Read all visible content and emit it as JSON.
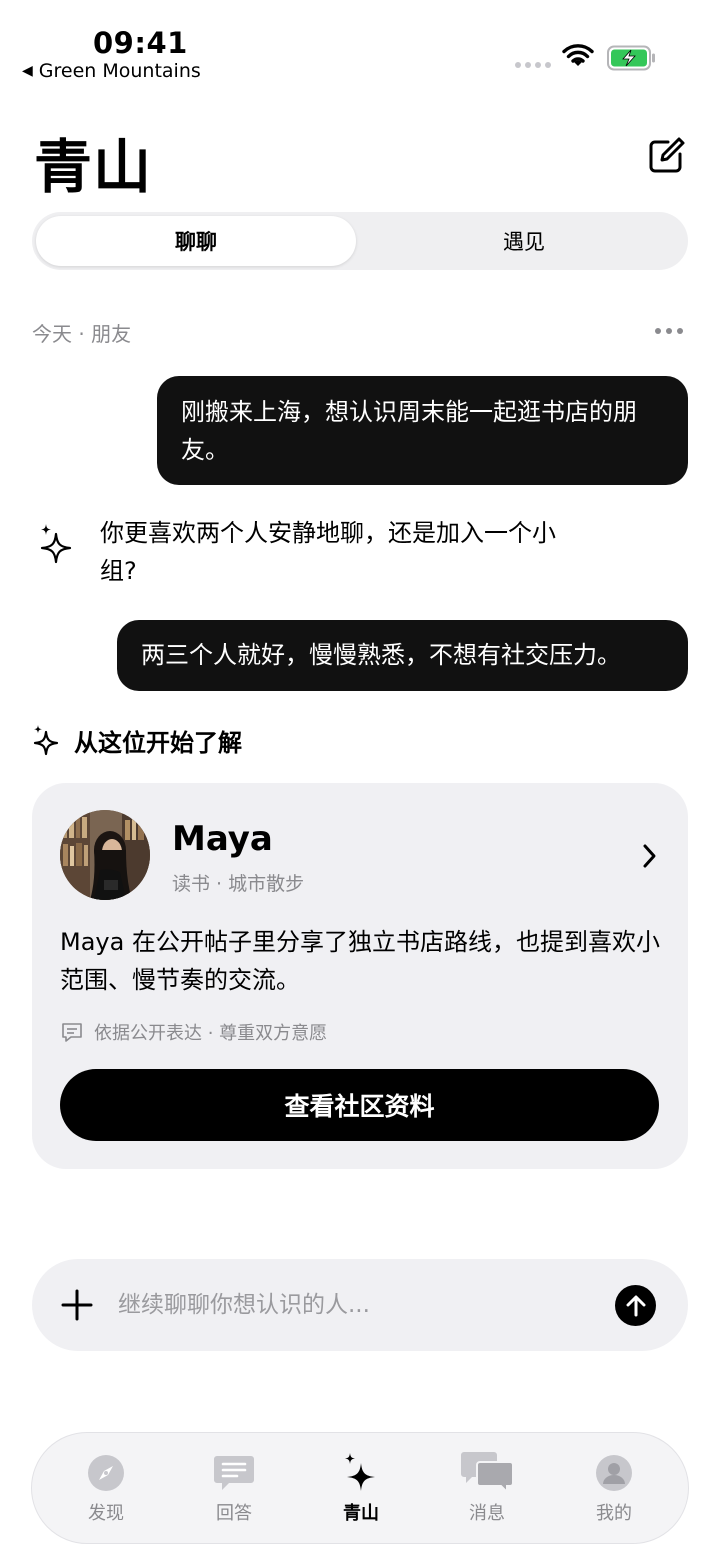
{
  "status_bar": {
    "time": "09:41",
    "back_label": "Green Mountains",
    "battery_color": "#34c759"
  },
  "header": {
    "title": "青山",
    "compose_icon": "compose-icon"
  },
  "segmented": {
    "tabs": [
      {
        "label": "聊聊",
        "selected": true
      },
      {
        "label": "遇见",
        "selected": false
      }
    ]
  },
  "chat": {
    "meta": "今天 · 朋友",
    "messages": [
      {
        "role": "user",
        "text": "刚搬来上海，想认识周末能一起逛书店的朋友。"
      },
      {
        "role": "assistant",
        "text": "你更喜欢两个人安静地聊，还是加入一个小组?"
      },
      {
        "role": "user",
        "text": "两三个人就好，慢慢熟悉，不想有社交压力。"
      }
    ],
    "section_label": "从这位开始了解"
  },
  "profile_card": {
    "name": "Maya",
    "tags": "读书 · 城市散步",
    "description": "Maya 在公开帖子里分享了独立书店路线，也提到喜欢小范围、慢节奏的交流。",
    "note": "依据公开表达 · 尊重双方意愿",
    "cta_label": "查看社区资料"
  },
  "composer": {
    "placeholder": "继续聊聊你想认识的人..."
  },
  "tab_bar": {
    "items": [
      {
        "label": "发现",
        "icon": "compass-icon",
        "active": false
      },
      {
        "label": "回答",
        "icon": "answer-bubble-icon",
        "active": false
      },
      {
        "label": "青山",
        "icon": "sparkle-icon",
        "active": true
      },
      {
        "label": "消息",
        "icon": "messages-icon",
        "active": false
      },
      {
        "label": "我的",
        "icon": "profile-icon",
        "active": false
      }
    ]
  }
}
